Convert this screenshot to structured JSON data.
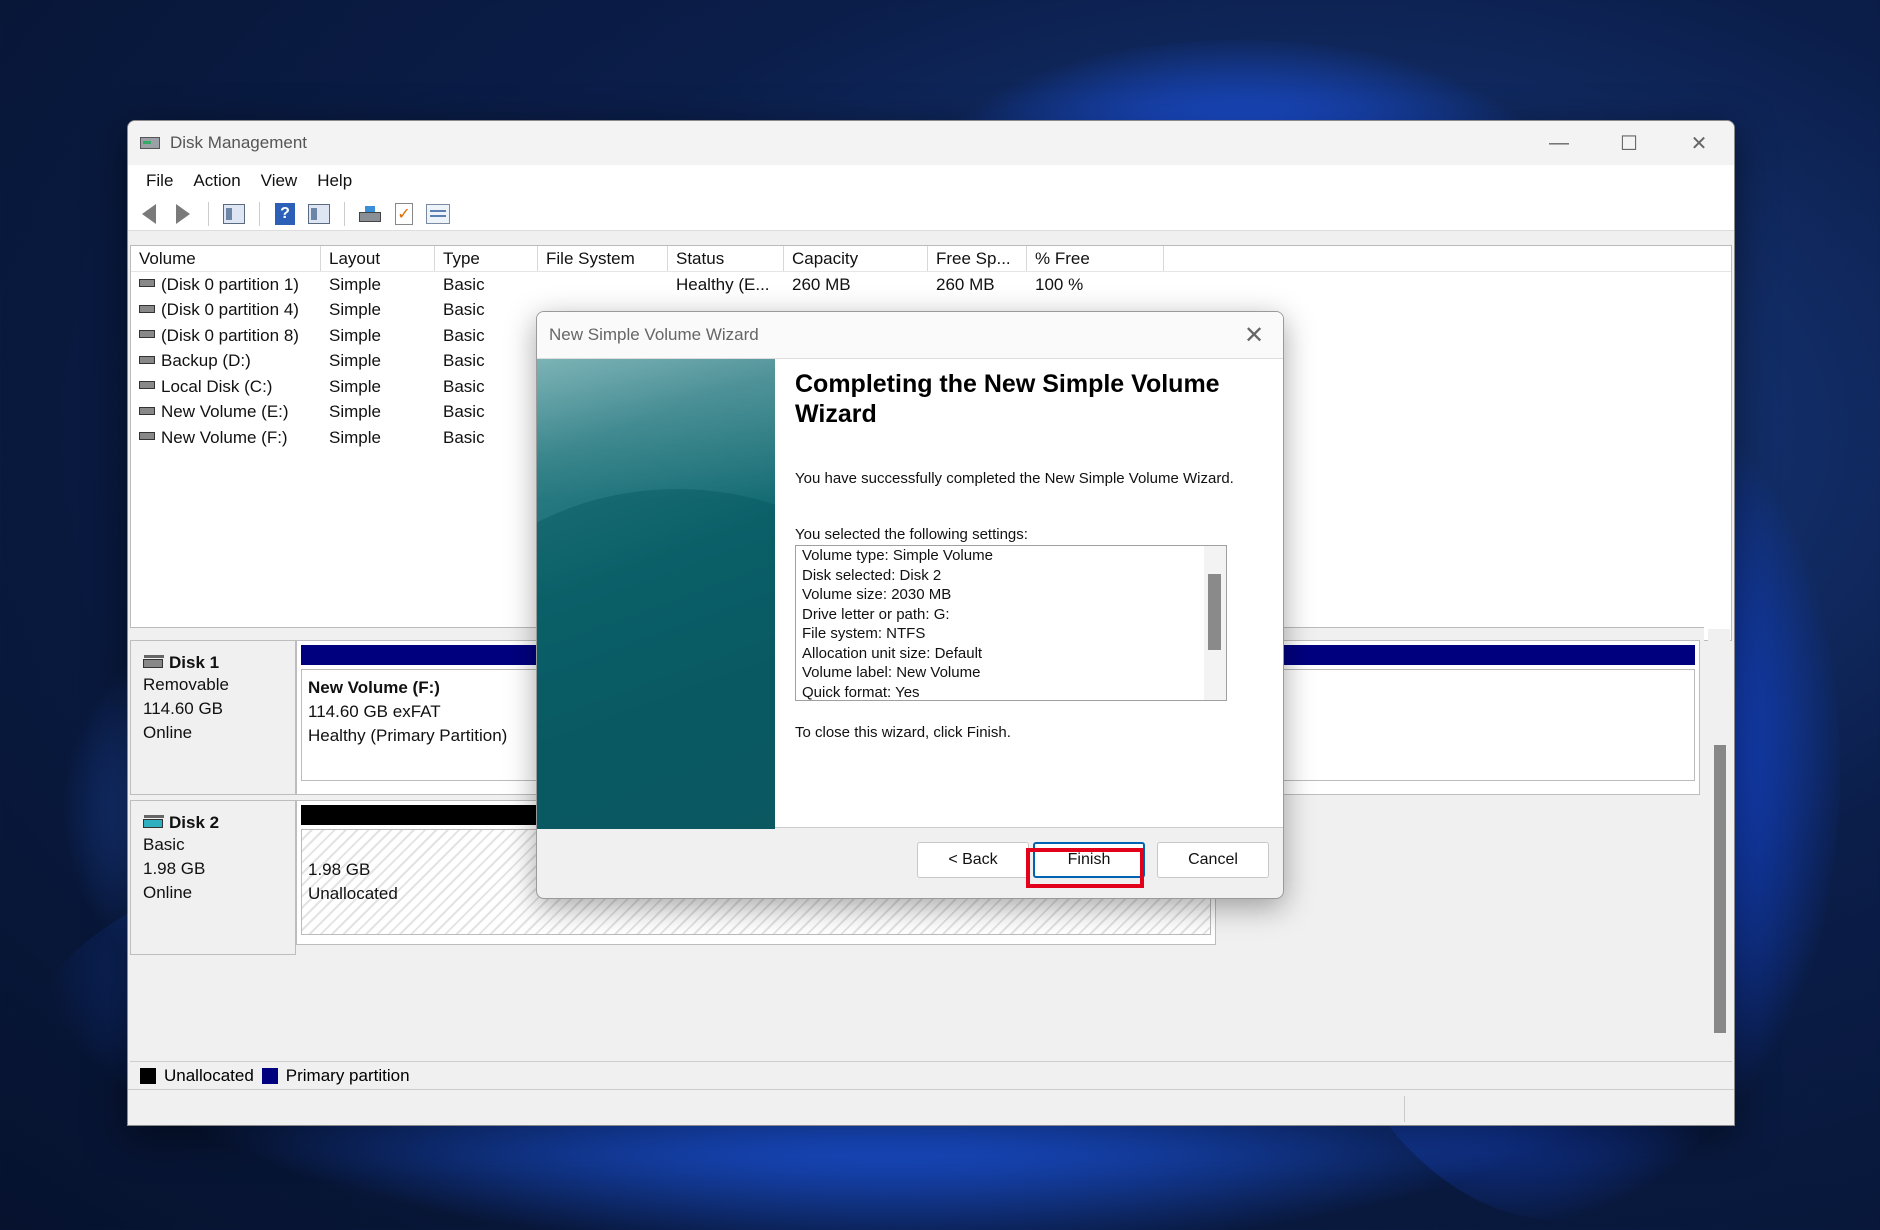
{
  "window": {
    "title": "Disk Management",
    "minimize_glyph": "—",
    "maximize_glyph": "☐",
    "close_glyph": "✕"
  },
  "menu": [
    "File",
    "Action",
    "View",
    "Help"
  ],
  "toolbar_icons": [
    "back-arrow-icon",
    "forward-arrow-icon",
    "console-tree-icon",
    "help-icon",
    "properties-icon",
    "rescan-disks-icon",
    "checklist-icon",
    "settings-list-icon"
  ],
  "volume_list": {
    "columns": [
      "Volume",
      "Layout",
      "Type",
      "File System",
      "Status",
      "Capacity",
      "Free Sp...",
      "% Free"
    ],
    "rows": [
      {
        "volume": "(Disk 0 partition 1)",
        "layout": "Simple",
        "type": "Basic",
        "fs": "",
        "status": "Healthy (E...",
        "capacity": "260 MB",
        "free": "260 MB",
        "pct": "100 %"
      },
      {
        "volume": "(Disk 0 partition 4)",
        "layout": "Simple",
        "type": "Basic",
        "fs": "",
        "status": "",
        "capacity": "",
        "free": "",
        "pct": ""
      },
      {
        "volume": "(Disk 0 partition 8)",
        "layout": "Simple",
        "type": "Basic",
        "fs": "",
        "status": "",
        "capacity": "",
        "free": "",
        "pct": ""
      },
      {
        "volume": "Backup (D:)",
        "layout": "Simple",
        "type": "Basic",
        "fs": "",
        "status": "",
        "capacity": "",
        "free": "",
        "pct": ""
      },
      {
        "volume": "Local Disk (C:)",
        "layout": "Simple",
        "type": "Basic",
        "fs": "",
        "status": "",
        "capacity": "",
        "free": "",
        "pct": ""
      },
      {
        "volume": "New Volume (E:)",
        "layout": "Simple",
        "type": "Basic",
        "fs": "",
        "status": "",
        "capacity": "",
        "free": "",
        "pct": ""
      },
      {
        "volume": "New Volume (F:)",
        "layout": "Simple",
        "type": "Basic",
        "fs": "",
        "status": "",
        "capacity": "",
        "free": "",
        "pct": ""
      }
    ]
  },
  "disks": [
    {
      "name": "Disk 1",
      "line1": "Removable",
      "line2": "114.60 GB",
      "line3": "Online",
      "partition": {
        "title": "New Volume  (F:)",
        "line1": "114.60 GB exFAT",
        "line2": "Healthy (Primary Partition)",
        "bar_color": "#00007f"
      }
    },
    {
      "name": "Disk 2",
      "line1": "Basic",
      "line2": "1.98 GB",
      "line3": "Online",
      "partition": {
        "title": "",
        "line1": "1.98 GB",
        "line2": "Unallocated",
        "bar_color": "#000000"
      }
    }
  ],
  "legend": [
    {
      "label": "Unallocated",
      "color": "#000000"
    },
    {
      "label": "Primary partition",
      "color": "#00007f"
    }
  ],
  "wizard": {
    "title": "New Simple Volume Wizard",
    "close_glyph": "✕",
    "heading": "Completing the New Simple Volume Wizard",
    "intro": "You have successfully completed the New Simple Volume Wizard.",
    "settings_label": "You selected the following settings:",
    "settings": [
      "Volume type: Simple Volume",
      "Disk selected: Disk 2",
      "Volume size: 2030 MB",
      "Drive letter or path: G:",
      "File system: NTFS",
      "Allocation unit size: Default",
      "Volume label: New Volume",
      "Quick format: Yes"
    ],
    "close_hint": "To close this wizard, click Finish.",
    "buttons": {
      "back": "< Back",
      "finish": "Finish",
      "cancel": "Cancel"
    }
  },
  "colors": {
    "highlight": "#e2001a",
    "primary_partition": "#00007f",
    "accent": "#0063b1"
  }
}
